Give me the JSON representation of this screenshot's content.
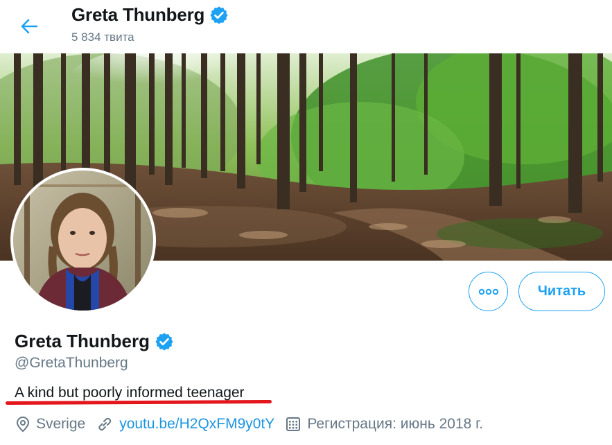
{
  "header": {
    "name": "Greta Thunberg",
    "tweet_count": "5 834 твита"
  },
  "profile": {
    "name": "Greta Thunberg",
    "handle": "@GretaThunberg",
    "bio": "A kind but poorly informed teenager",
    "location": "Sverige",
    "website": "youtu.be/H2QxFM9y0tY",
    "joined": "Регистрация: июнь 2018 г."
  },
  "actions": {
    "follow_label": "Читать",
    "more_icon": "more-icon"
  },
  "colors": {
    "accent": "#1da1f2",
    "link": "#1b95e0",
    "secondary_text": "#657786",
    "highlight_underline": "#e3161b"
  },
  "icons": {
    "back": "arrow-left-icon",
    "verified": "verified-badge-icon",
    "location": "location-pin-icon",
    "link": "link-icon",
    "calendar": "calendar-icon"
  }
}
